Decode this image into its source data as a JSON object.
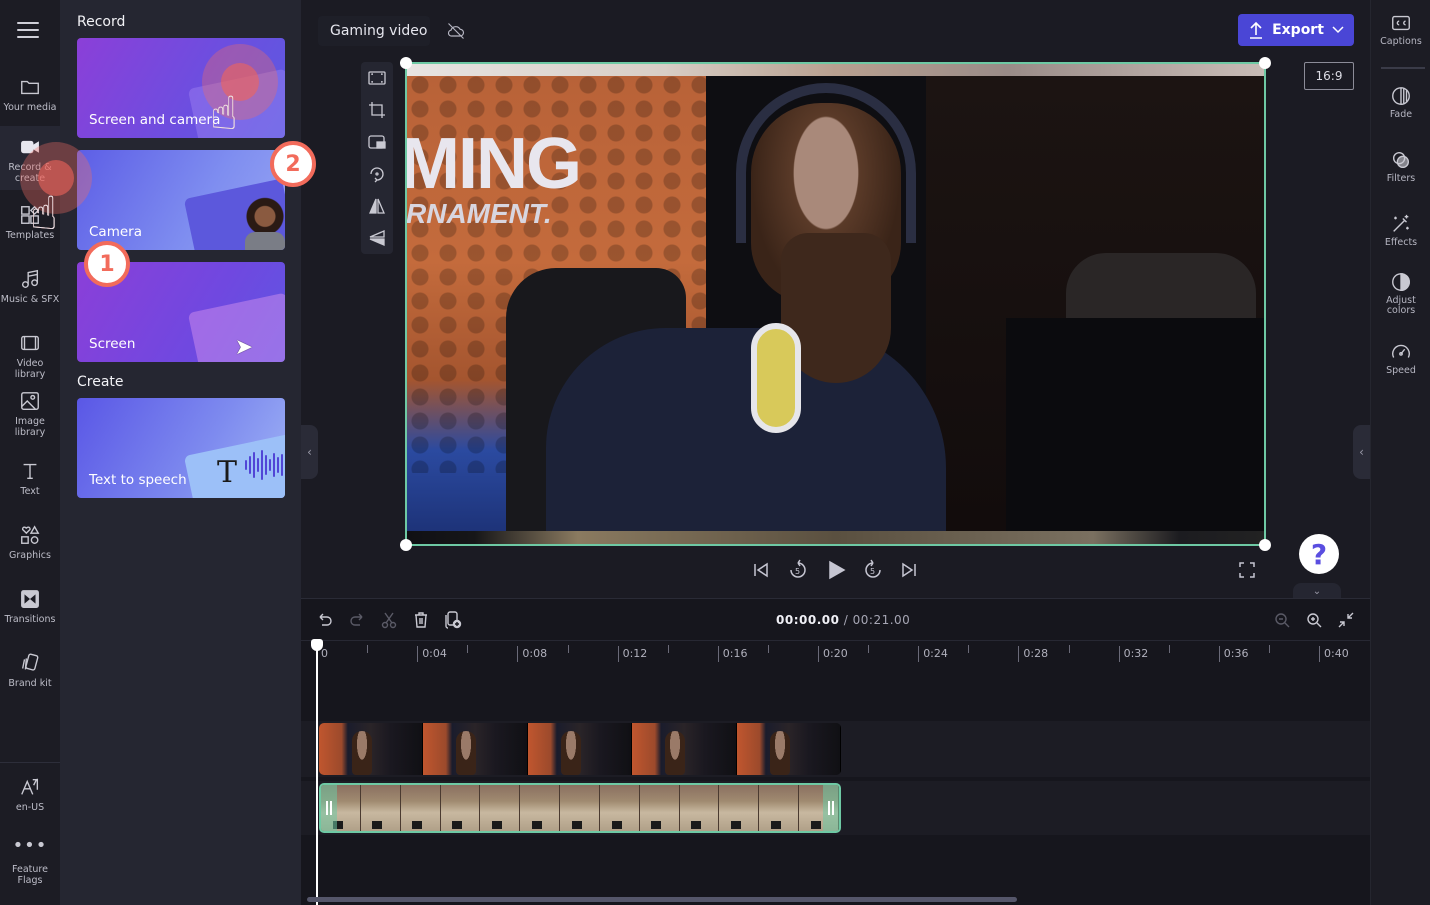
{
  "nav": {
    "menu_icon": "hamburger-icon",
    "items": [
      {
        "label": "Your media",
        "icon": "folder-icon"
      },
      {
        "label": "Record & create",
        "icon": "video-camera-icon",
        "active": true
      },
      {
        "label": "Templates",
        "icon": "templates-icon"
      },
      {
        "label": "Music & SFX",
        "icon": "music-icon"
      },
      {
        "label": "Video library",
        "icon": "film-icon"
      },
      {
        "label": "Image library",
        "icon": "image-icon"
      },
      {
        "label": "Text",
        "icon": "text-icon"
      },
      {
        "label": "Graphics",
        "icon": "shapes-icon"
      },
      {
        "label": "Transitions",
        "icon": "transition-icon"
      },
      {
        "label": "Brand kit",
        "icon": "brand-kit-icon"
      }
    ],
    "bottom": [
      {
        "label": "en-US",
        "icon": "language-icon"
      },
      {
        "label": "Feature Flags",
        "icon": "more-icon"
      }
    ]
  },
  "panel": {
    "record_title": "Record",
    "create_title": "Create",
    "record_cards": [
      {
        "label": "Screen and camera"
      },
      {
        "label": "Camera"
      },
      {
        "label": "Screen"
      }
    ],
    "create_cards": [
      {
        "label": "Text to speech",
        "glyph": "T"
      }
    ]
  },
  "header": {
    "project_title": "Gaming video",
    "cloud_status_icon": "cloud-off-icon",
    "export_label": "Export",
    "aspect_ratio": "16:9"
  },
  "preview_tools": [
    "fit-icon",
    "crop-icon",
    "picture-in-picture-icon",
    "rotate-icon",
    "flip-horizontal-icon",
    "flip-vertical-icon"
  ],
  "preview": {
    "banner_text_1": "MING",
    "banner_text_2": "RNAMENT."
  },
  "right_rail": [
    {
      "label": "Captions",
      "icon": "cc-icon"
    },
    {
      "label": "Fade",
      "icon": "fade-icon"
    },
    {
      "label": "Filters",
      "icon": "filters-icon"
    },
    {
      "label": "Effects",
      "icon": "magic-wand-icon"
    },
    {
      "label": "Adjust colors",
      "icon": "contrast-icon"
    },
    {
      "label": "Speed",
      "icon": "speedometer-icon"
    }
  ],
  "playback": {
    "skip_back_seconds": "5",
    "skip_forward_seconds": "5"
  },
  "help": {
    "glyph": "?"
  },
  "timeline": {
    "current_time": "00:00.00",
    "separator": " / ",
    "total_time": "00:21.00",
    "ticks": [
      "0",
      "0:04",
      "0:08",
      "0:12",
      "0:16",
      "0:20",
      "0:24",
      "0:28",
      "0:32",
      "0:36",
      "0:40"
    ]
  },
  "tutorial": {
    "step1": "1",
    "step2": "2"
  }
}
